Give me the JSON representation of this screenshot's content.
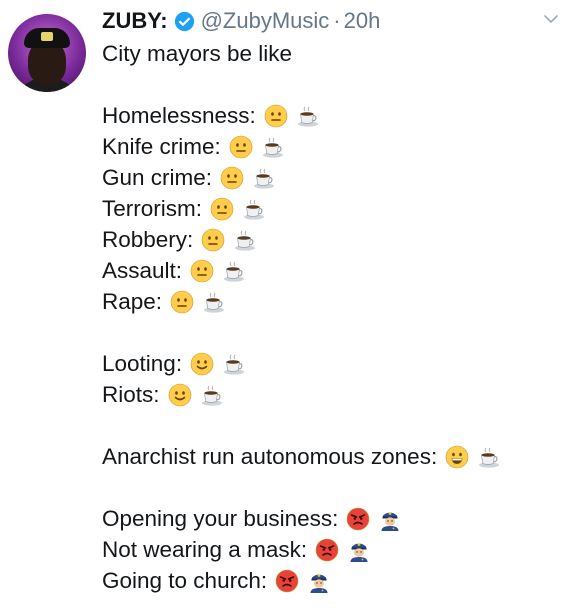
{
  "tweet": {
    "author_name": "ZUBY:",
    "handle": "@ZubyMusic",
    "separator": "·",
    "time": "20h",
    "intro": "City mayors be like",
    "lines": [
      {
        "label": "Homelessness:",
        "emojis": [
          "neutral-face-icon",
          "coffee-icon"
        ]
      },
      {
        "label": "Knife crime:",
        "emojis": [
          "neutral-face-icon",
          "coffee-icon"
        ]
      },
      {
        "label": "Gun crime:",
        "emojis": [
          "neutral-face-icon",
          "coffee-icon"
        ]
      },
      {
        "label": "Terrorism:",
        "emojis": [
          "neutral-face-icon",
          "coffee-icon"
        ]
      },
      {
        "label": "Robbery:",
        "emojis": [
          "neutral-face-icon",
          "coffee-icon"
        ]
      },
      {
        "label": "Assault:",
        "emojis": [
          "neutral-face-icon",
          "coffee-icon"
        ]
      },
      {
        "label": "Rape:",
        "emojis": [
          "neutral-face-icon",
          "coffee-icon"
        ]
      },
      {
        "label": "Looting:",
        "emojis": [
          "smiling-face-icon",
          "coffee-icon"
        ]
      },
      {
        "label": "Riots:",
        "emojis": [
          "smiling-face-icon",
          "coffee-icon"
        ]
      },
      {
        "label": "Anarchist run autonomous zones:",
        "emojis": [
          "grinning-face-icon",
          "coffee-icon"
        ]
      },
      {
        "label": "Opening your business:",
        "emojis": [
          "angry-face-icon",
          "police-officer-icon"
        ]
      },
      {
        "label": "Not wearing a mask:",
        "emojis": [
          "angry-face-icon",
          "police-officer-icon"
        ]
      },
      {
        "label": "Going to church:",
        "emojis": [
          "angry-face-icon",
          "police-officer-icon"
        ]
      }
    ]
  },
  "colors": {
    "text": "#14171a",
    "muted": "#657786",
    "verified": "#1da1f2",
    "emoji_yellow": "#ffcc4d",
    "emoji_angry": "#e8433a",
    "police_blue": "#2a4d8f"
  },
  "icons": {
    "verified": "verified-badge-icon",
    "menu": "chevron-down-icon"
  }
}
